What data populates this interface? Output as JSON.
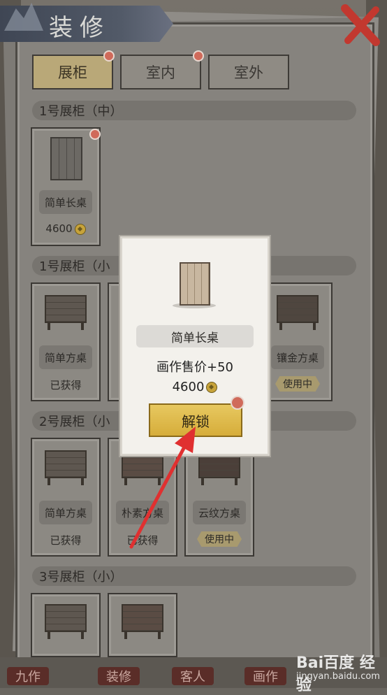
{
  "header": {
    "title": "装修"
  },
  "tabs": [
    {
      "label": "展柜",
      "active": true,
      "badge": true
    },
    {
      "label": "室内",
      "active": false,
      "badge": true
    },
    {
      "label": "室外",
      "active": false,
      "badge": false
    }
  ],
  "sections": [
    {
      "title": "1号展柜（中）"
    },
    {
      "title": "1号展柜（小"
    },
    {
      "title": "2号展柜（小"
    },
    {
      "title": "3号展柜（小）"
    }
  ],
  "cards": {
    "s1": [
      {
        "name": "简单长桌",
        "price": "4600"
      }
    ],
    "s2": [
      {
        "name": "简单方桌",
        "status": "已获得"
      },
      {
        "name": "镶金方桌",
        "status": "使用中"
      }
    ],
    "s3": [
      {
        "name": "简单方桌",
        "status": "已获得"
      },
      {
        "name": "朴素方桌",
        "status": "已获得"
      },
      {
        "name": "云纹方桌",
        "status": "使用中"
      }
    ]
  },
  "popup": {
    "name": "简单长桌",
    "bonus": "画作售价+50",
    "price": "4600",
    "button_label": "解锁"
  },
  "bottom_nav": [
    "九作",
    "装修",
    "客人",
    "画作"
  ],
  "watermark": {
    "logo": "Bai百度 经验",
    "url": "jingyan.baidu.com"
  },
  "colors": {
    "accent_gold": "#d6ad3a",
    "badge_red": "#d06a5a",
    "arrow_red": "#e03030"
  },
  "icons": [
    "close-icon",
    "coin-icon",
    "mountain-icon"
  ]
}
